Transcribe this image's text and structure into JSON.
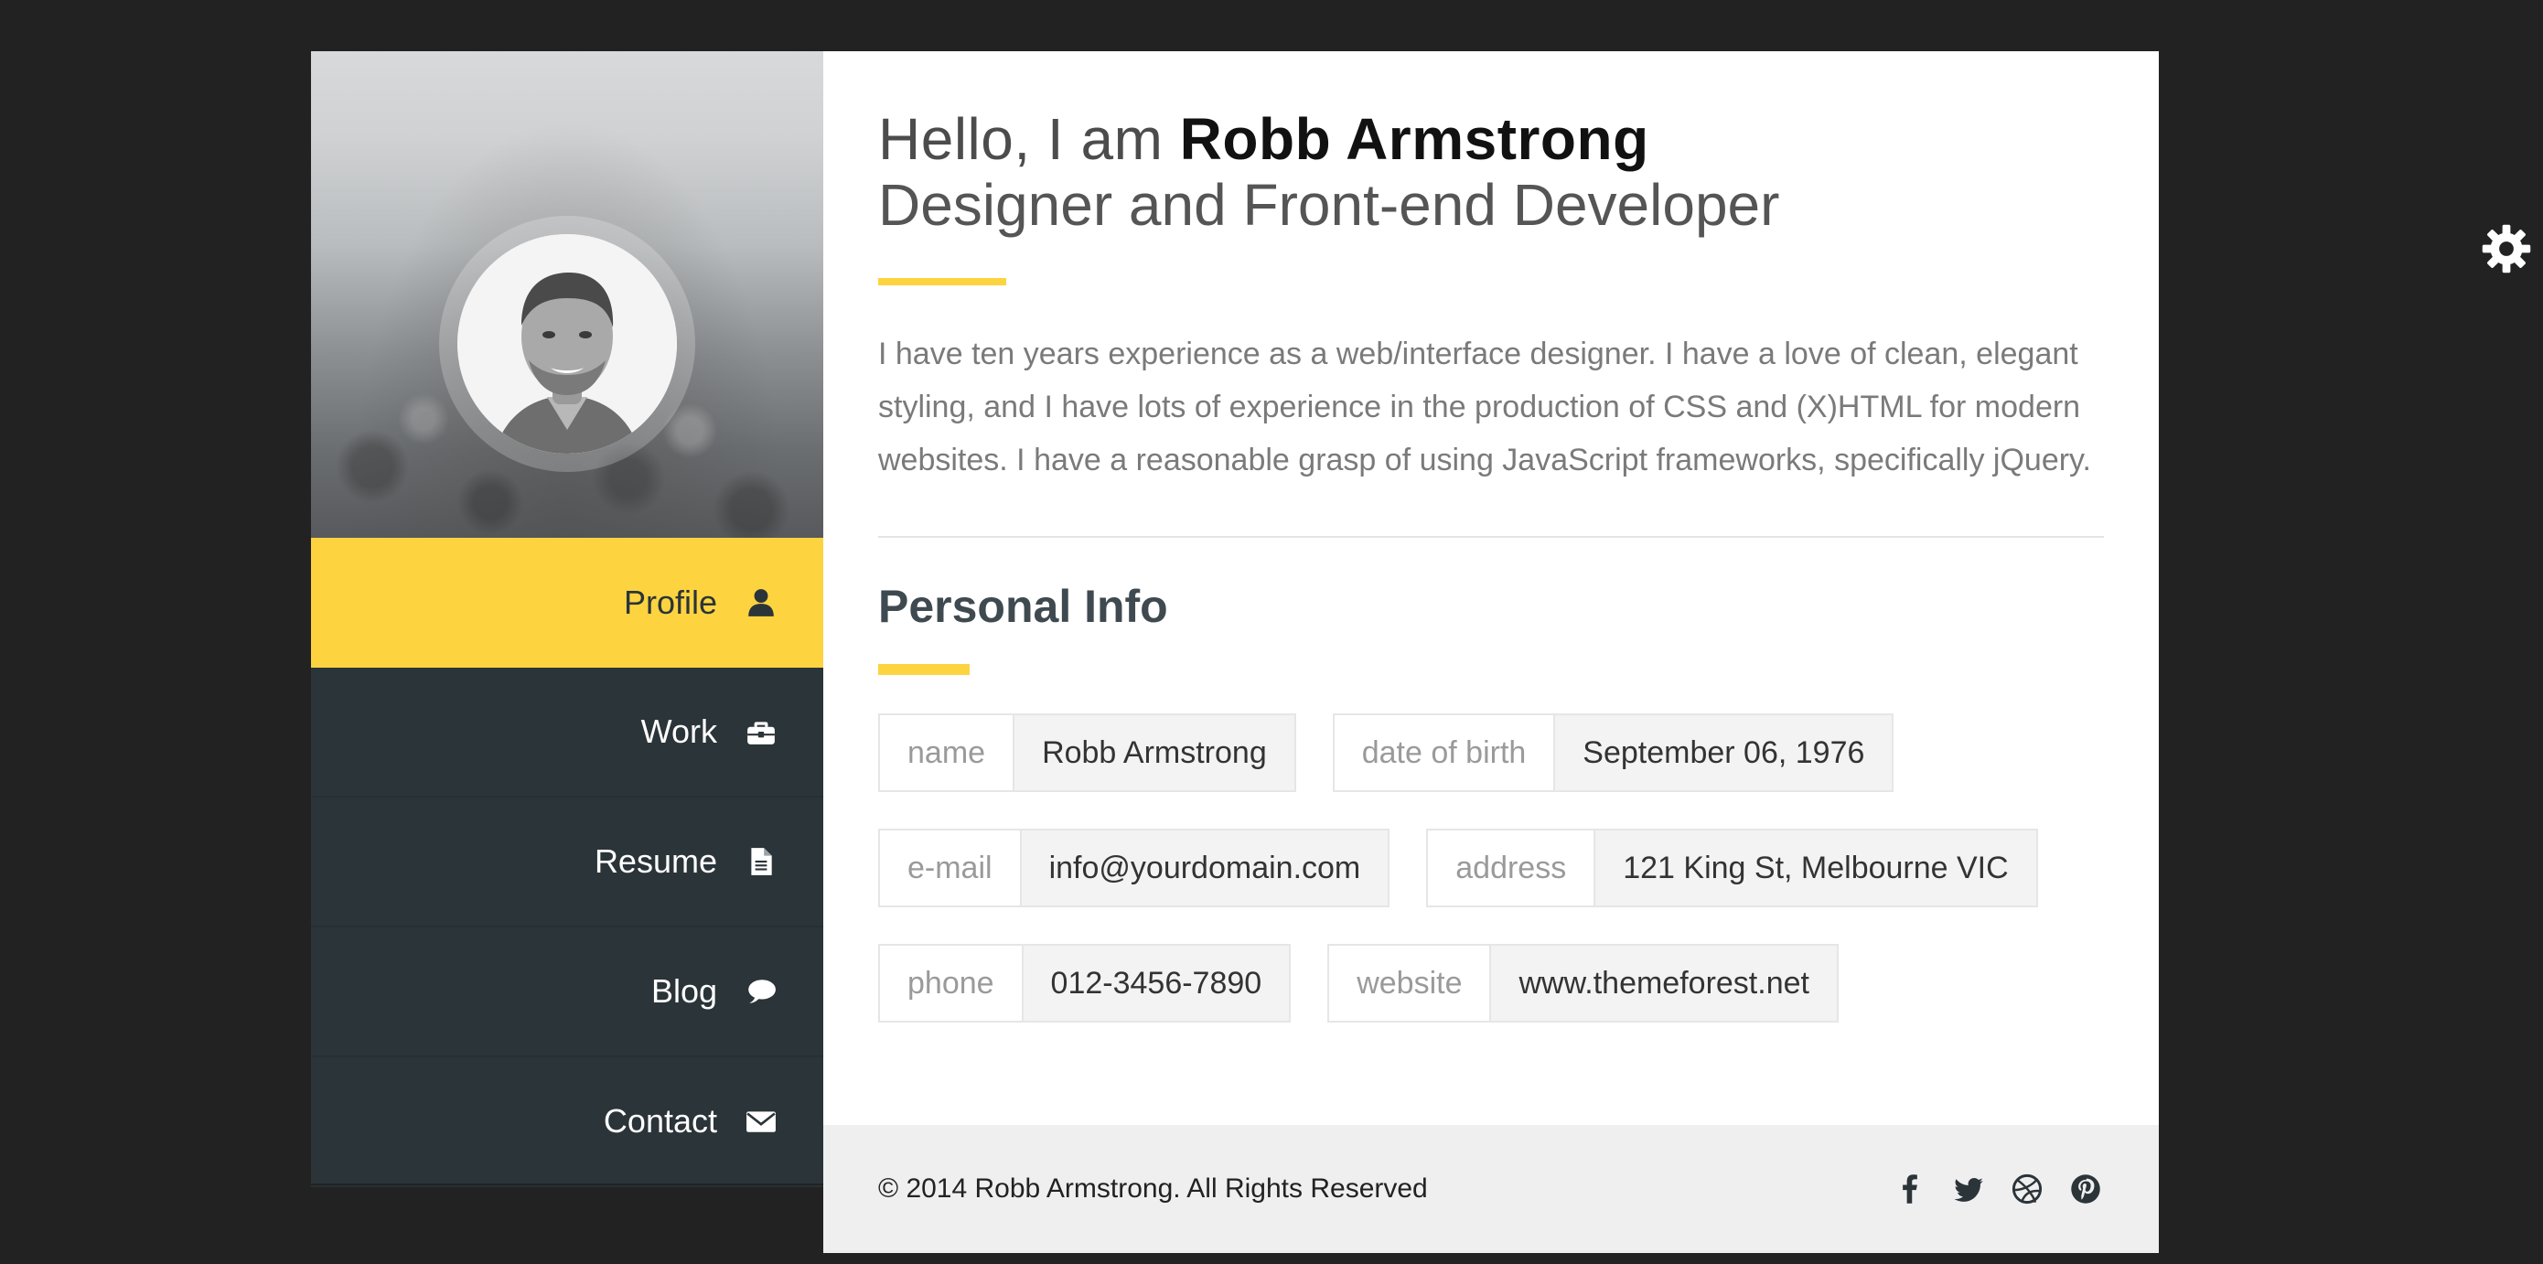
{
  "sidebar": {
    "avatar_alt": "Profile photo",
    "nav": [
      {
        "label": "Profile",
        "icon": "user-icon",
        "active": true
      },
      {
        "label": "Work",
        "icon": "briefcase-icon",
        "active": false
      },
      {
        "label": "Resume",
        "icon": "document-icon",
        "active": false
      },
      {
        "label": "Blog",
        "icon": "speech-bubble-icon",
        "active": false
      },
      {
        "label": "Contact",
        "icon": "envelope-icon",
        "active": false
      }
    ]
  },
  "header": {
    "greeting": "Hello, I am ",
    "name": "Robb Armstrong",
    "subtitle": "Designer and Front-end Developer"
  },
  "bio": "I have ten years experience as a web/interface designer. I have a love of clean, elegant styling, and I have lots of experience in the production of CSS and (X)HTML for modern websites. I have a reasonable grasp of using JavaScript frameworks, specifically jQuery.",
  "personal_info": {
    "title": "Personal Info",
    "fields": [
      {
        "key": "name",
        "value": "Robb Armstrong"
      },
      {
        "key": "date of birth",
        "value": "September 06, 1976"
      },
      {
        "key": "e-mail",
        "value": "info@yourdomain.com"
      },
      {
        "key": "address",
        "value": "121 King St, Melbourne VIC"
      },
      {
        "key": "phone",
        "value": "012-3456-7890"
      },
      {
        "key": "website",
        "value": "www.themeforest.net"
      }
    ]
  },
  "footer": {
    "copyright": "© 2014 Robb Armstrong. All Rights Reserved",
    "social": [
      "facebook-icon",
      "twitter-icon",
      "dribbble-icon",
      "pinterest-icon"
    ]
  },
  "settings": {
    "icon": "gear-icon"
  },
  "colors": {
    "accent": "#fdd440",
    "sidebar": "#2b3438",
    "background": "#222222",
    "footer": "#efefef"
  }
}
